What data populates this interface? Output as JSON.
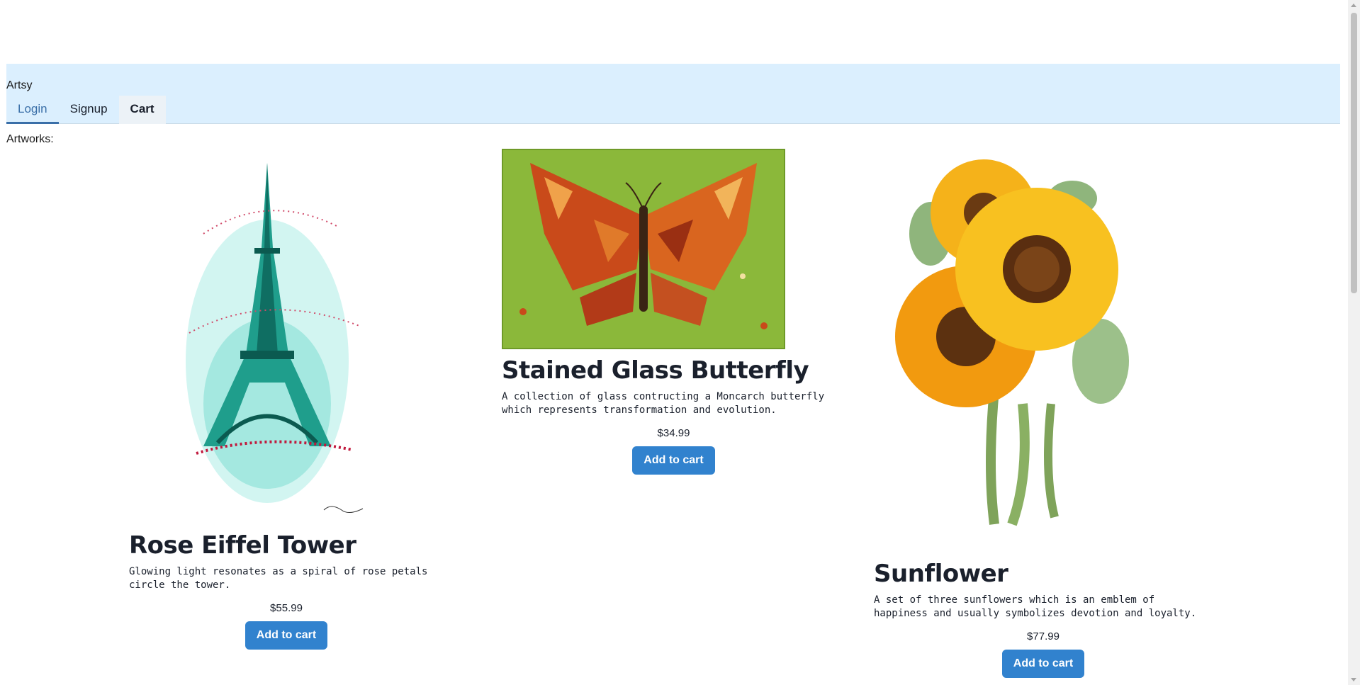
{
  "nav": {
    "brand": "Artsy",
    "tabs": [
      {
        "label": "Login"
      },
      {
        "label": "Signup"
      },
      {
        "label": "Cart"
      }
    ]
  },
  "main": {
    "heading": "Artworks:",
    "artworks": [
      {
        "title": "Rose Eiffel Tower",
        "description": "Glowing light resonates as a spiral of rose petals circle the tower.",
        "price": "$55.99",
        "button": "Add to cart",
        "image_icon": "eiffel-tower-painting"
      },
      {
        "title": "Stained Glass Butterfly",
        "description": "A collection of glass contructing a Moncarch butterfly which represents transformation and evolution.",
        "price": "$34.99",
        "button": "Add to cart",
        "image_icon": "butterfly-painting"
      },
      {
        "title": "Sunflower",
        "description": "A set of three sunflowers which is an emblem of happiness and usually symbolizes devotion and loyalty.",
        "price": "$77.99",
        "button": "Add to cart",
        "image_icon": "sunflower-painting"
      }
    ]
  },
  "colors": {
    "nav_bg": "#dbeffe",
    "accent": "#3182ce",
    "active_tab": "#3a6fa8"
  }
}
